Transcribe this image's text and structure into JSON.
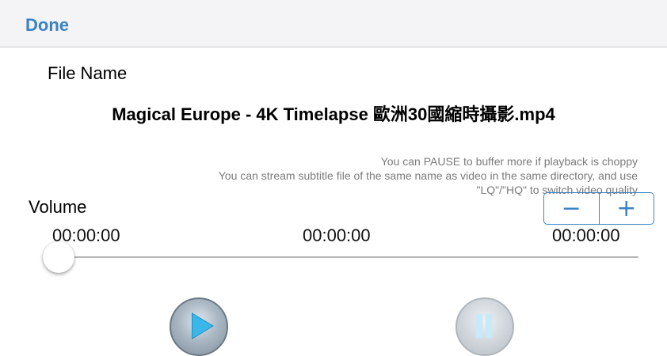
{
  "navbar": {
    "done_label": "Done"
  },
  "file": {
    "label": "File Name",
    "name": "Magical Europe - 4K Timelapse 歐洲30國縮時攝影.mp4"
  },
  "hints": {
    "line1": "You can PAUSE to buffer more if playback is choppy",
    "line2": "You can stream subtitle file of the same name as video in the same directory, and use",
    "line3": "\"LQ\"/\"HQ\" to switch video quality"
  },
  "volume": {
    "label": "Volume",
    "decrease_label": "−",
    "increase_label": "+"
  },
  "times": {
    "left": "00:00:00",
    "middle": "00:00:00",
    "right": "00:00:00"
  },
  "progress": 0,
  "controls": {
    "play_icon": "play-icon",
    "pause_icon": "pause-icon"
  },
  "colors": {
    "accent": "#3b83c4",
    "navbar_bg": "#f4f4f6",
    "hint_text": "#7a7a7a"
  }
}
